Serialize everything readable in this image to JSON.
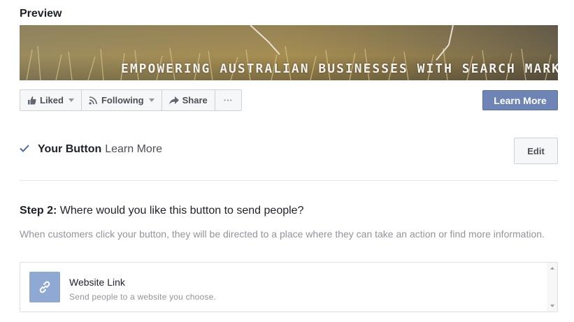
{
  "preview": {
    "title": "Preview",
    "cover_text": "EMPOWERING AUSTRALIAN BUSINESSES WITH SEARCH MARKETING"
  },
  "actions": {
    "liked_label": "Liked",
    "following_label": "Following",
    "share_label": "Share",
    "more_label": "···",
    "learn_more_label": "Learn More"
  },
  "your_button": {
    "label": "Your Button",
    "value": "Learn More",
    "edit_label": "Edit"
  },
  "step2": {
    "step_label": "Step 2:",
    "question": "Where would you like this button to send people?",
    "description": "When customers click your button, they will be directed to a place where they can take an action or find more information."
  },
  "options": [
    {
      "title": "Website Link",
      "subtitle": "Send people to a website you choose.",
      "icon": "link-icon"
    }
  ],
  "colors": {
    "primary_button": "#6d84b4",
    "option_icon_bg": "#8fa8d4",
    "check_color": "#4b6a9b"
  }
}
